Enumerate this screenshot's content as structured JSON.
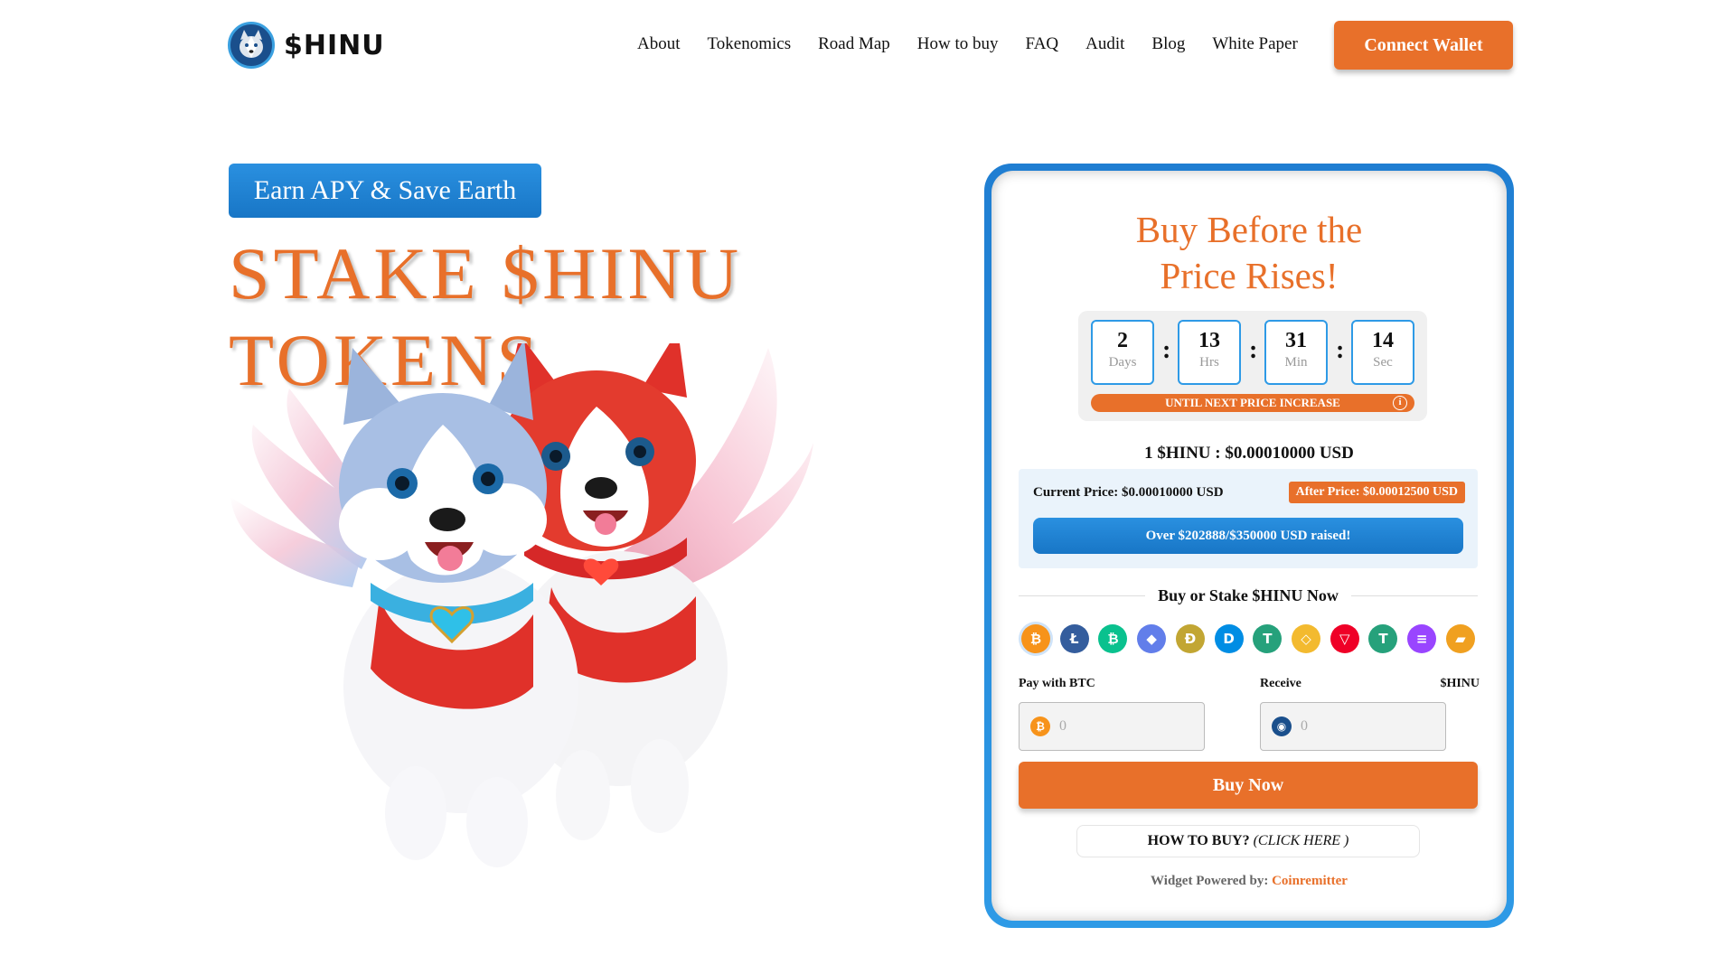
{
  "nav": {
    "logo_text": "$HINU",
    "items": [
      "About",
      "Tokenomics",
      "Road Map",
      "How to buy",
      "FAQ",
      "Audit",
      "Blog",
      "White Paper"
    ],
    "connect_label": "Connect Wallet"
  },
  "hero": {
    "tag": "Earn APY & Save Earth",
    "headline_line1": "STAKE $HINU",
    "headline_line2": "TOKENS"
  },
  "widget": {
    "title_line1": "Buy Before the",
    "title_line2": "Price Rises!",
    "timer": {
      "days": "2",
      "days_label": "Days",
      "hrs": "13",
      "hrs_label": "Hrs",
      "min": "31",
      "min_label": "Min",
      "sec": "14",
      "sec_label": "Sec",
      "until_label": "UNTIL NEXT PRICE INCREASE"
    },
    "rate": "1 $HINU : $0.00010000 USD",
    "current_price": "Current Price: $0.00010000 USD",
    "after_price": "After Price: $0.00012500 USD",
    "raised": "Over $202888/$350000 USD raised!",
    "buy_or_stake": "Buy or Stake $HINU Now",
    "coins": [
      {
        "name": "btc-icon",
        "glyph": "₿",
        "color": "#f7931a"
      },
      {
        "name": "ltc-icon",
        "glyph": "Ł",
        "color": "#345d9d"
      },
      {
        "name": "bch-icon",
        "glyph": "₿",
        "color": "#0ac18e"
      },
      {
        "name": "eth-icon",
        "glyph": "◆",
        "color": "#627eea"
      },
      {
        "name": "doge-icon",
        "glyph": "Ð",
        "color": "#c2a633"
      },
      {
        "name": "dash-icon",
        "glyph": "D",
        "color": "#008de4"
      },
      {
        "name": "usdt-icon",
        "glyph": "T",
        "color": "#26a17b"
      },
      {
        "name": "bnb-icon",
        "glyph": "◇",
        "color": "#f3ba2f"
      },
      {
        "name": "trx-icon",
        "glyph": "▽",
        "color": "#ef0027"
      },
      {
        "name": "usdt-trc20-icon",
        "glyph": "T",
        "color": "#26a17b"
      },
      {
        "name": "sol-icon",
        "glyph": "≡",
        "color": "#9945ff"
      },
      {
        "name": "wallet-icon",
        "glyph": "▰",
        "color": "#f0a020"
      }
    ],
    "pay_label": "Pay with BTC",
    "receive_label": "Receive",
    "receive_unit": "$HINU",
    "pay_value": "0",
    "receive_value": "0",
    "buy_label": "Buy Now",
    "how_to_buy": "HOW TO BUY?",
    "click_here": "(CLICK HERE )",
    "powered_by": "Widget Powered by:",
    "powered_brand": "Coinremitter"
  },
  "colors": {
    "accent": "#e8702a",
    "blue": "#1f7ed2"
  }
}
